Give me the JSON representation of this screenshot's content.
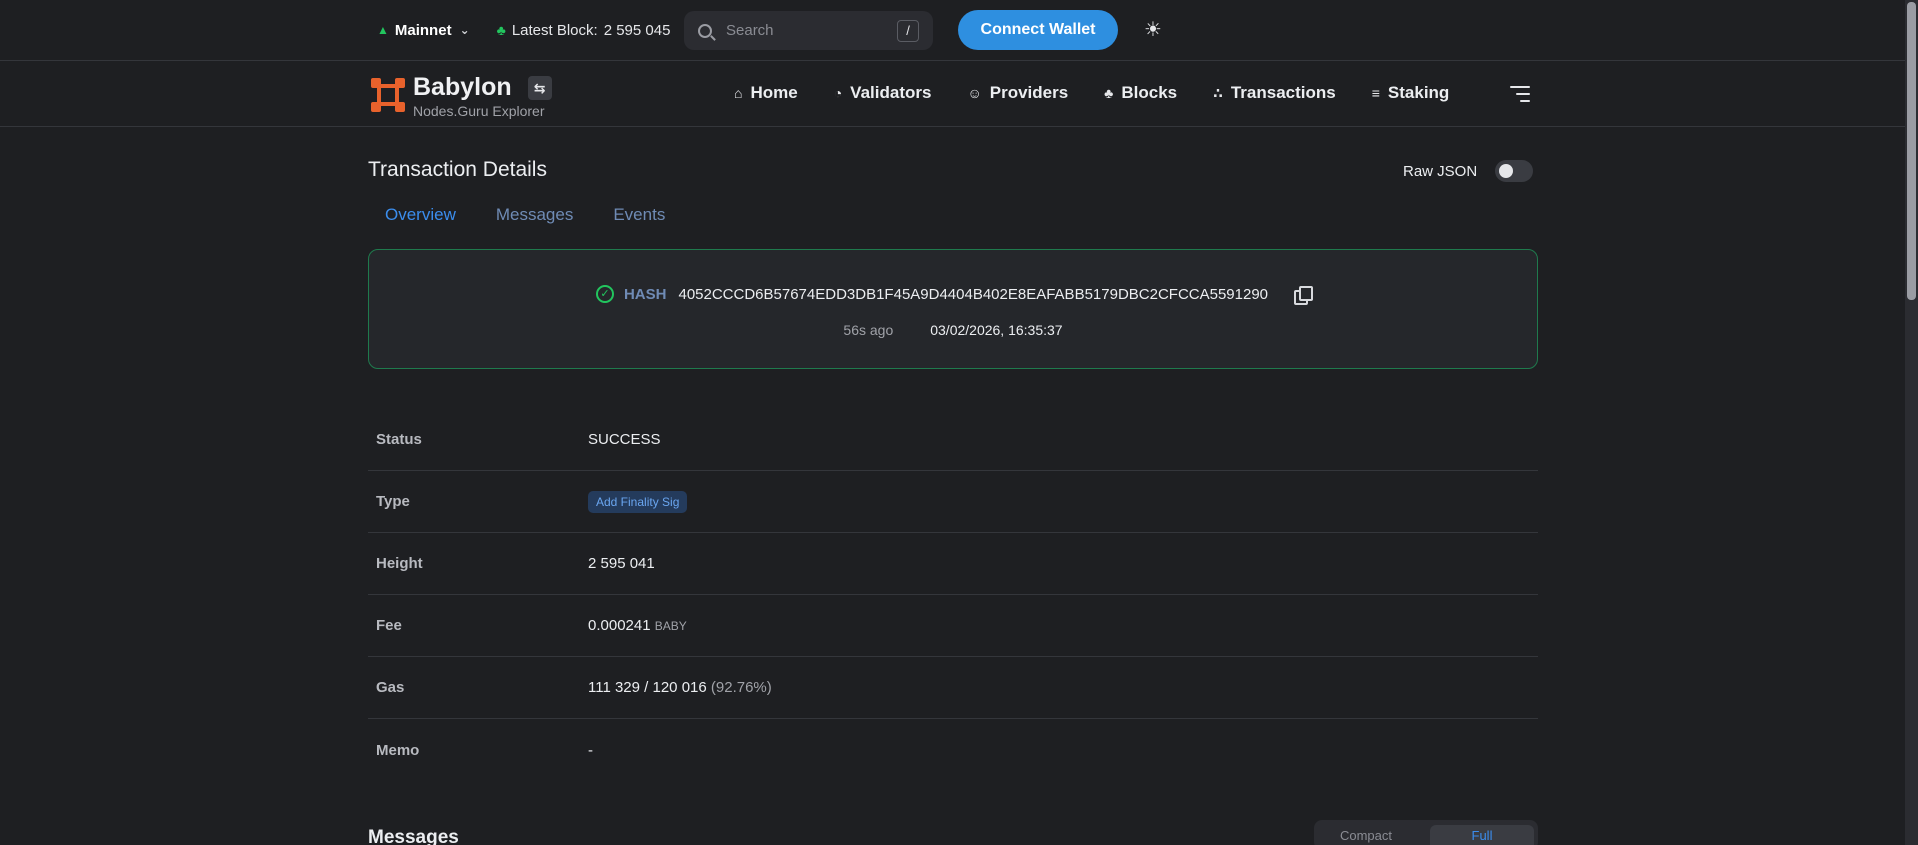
{
  "topbar": {
    "network": "Mainnet",
    "latest_block_label": "Latest Block:",
    "latest_block_value": "2 595 045",
    "search_placeholder": "Search",
    "search_shortcut": "/",
    "connect_wallet": "Connect Wallet",
    "theme_icon": "sun-icon"
  },
  "brand": {
    "title": "Babylon",
    "subtitle": "Nodes.Guru Explorer"
  },
  "nav": {
    "items": [
      {
        "label": "Home",
        "icon": "home-icon"
      },
      {
        "label": "Validators",
        "icon": "validators-icon"
      },
      {
        "label": "Providers",
        "icon": "providers-icon"
      },
      {
        "label": "Blocks",
        "icon": "blocks-icon"
      },
      {
        "label": "Transactions",
        "icon": "transactions-icon"
      },
      {
        "label": "Staking",
        "icon": "staking-icon"
      }
    ]
  },
  "page": {
    "title": "Transaction Details",
    "raw_json_label": "Raw JSON",
    "tabs": [
      "Overview",
      "Messages",
      "Events"
    ],
    "active_tab": "Overview"
  },
  "tx": {
    "hash_label": "HASH",
    "hash": "4052CCCD6B57674EDD3DB1F45A9D4404B402E8EAFABB5179DBC2CFCCA5591290",
    "ago": "56s ago",
    "datetime": "03/02/2026, 16:35:37"
  },
  "details": {
    "status_label": "Status",
    "status_value": "SUCCESS",
    "type_label": "Type",
    "type_value": "Add Finality Sig",
    "height_label": "Height",
    "height_value": "2 595 041",
    "fee_label": "Fee",
    "fee_value": "0.000241",
    "fee_unit": "BABY",
    "gas_label": "Gas",
    "gas_value": "111 329 / 120 016",
    "gas_pct": "(92.76%)",
    "memo_label": "Memo",
    "memo_value": "-"
  },
  "messages_section": {
    "title": "Messages",
    "compact": "Compact",
    "full": "Full"
  },
  "colors": {
    "background": "#1e1f22",
    "accent": "#2e8fe0",
    "success": "#22c55e",
    "link": "#3b8ded",
    "brand": "#e8622c"
  }
}
